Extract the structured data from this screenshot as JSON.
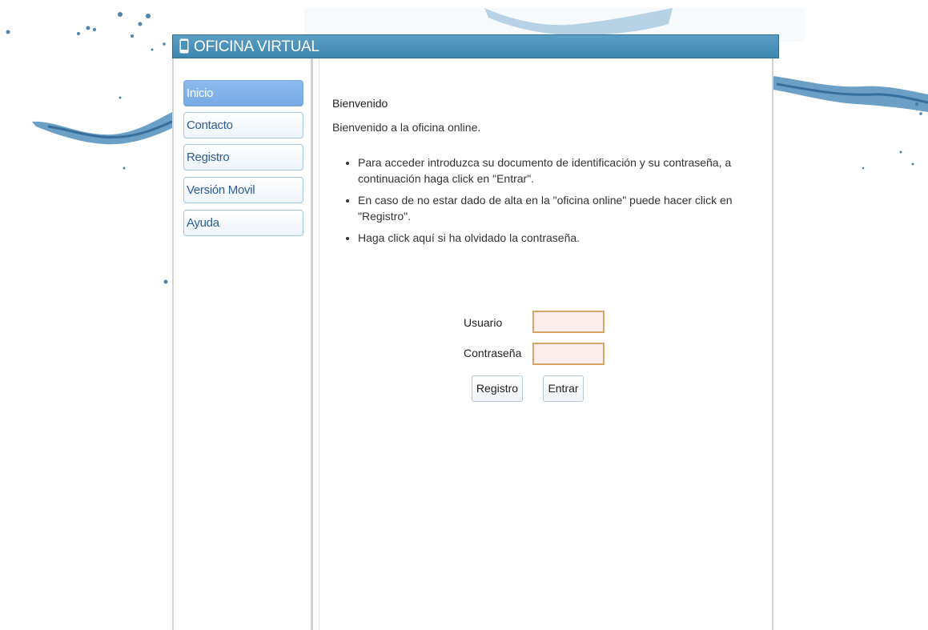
{
  "header": {
    "title": "OFICINA VIRTUAL",
    "icon": "mobile-phone-icon"
  },
  "sidebar": {
    "items": [
      {
        "label": "Inicio",
        "active": true
      },
      {
        "label": "Contacto",
        "active": false
      },
      {
        "label": "Registro",
        "active": false
      },
      {
        "label": "Versión Movil",
        "active": false
      },
      {
        "label": "Ayuda",
        "active": false
      }
    ]
  },
  "main": {
    "welcome_title": "Bienvenido",
    "welcome_text": "Bienvenido a la oficina online.",
    "instructions": [
      "Para acceder introduzca su documento de identificación y su contraseña, a continuación haga click en \"Entrar\".",
      "En caso de no estar dado de alta en la \"oficina online\" puede hacer click en \"Registro\".",
      "Haga click aquí si ha olvidado la contraseña."
    ]
  },
  "login": {
    "user_label": "Usuario",
    "user_value": "",
    "password_label": "Contraseña",
    "password_value": "",
    "register_button": "Registro",
    "enter_button": "Entrar"
  },
  "colors": {
    "header": "#4a92bd",
    "nav_active": "#80b2ea",
    "nav_text": "#2a5d9b",
    "input_border": "#d8a46a",
    "input_bg": "#fdeeee"
  }
}
